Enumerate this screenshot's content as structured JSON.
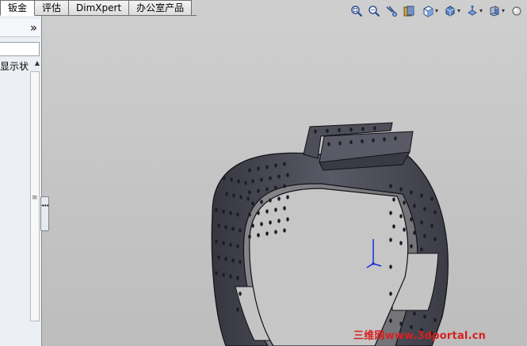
{
  "command_tabs": [
    {
      "label": "钣金",
      "active": true
    },
    {
      "label": "评估",
      "active": false
    },
    {
      "label": "DimXpert",
      "active": false
    },
    {
      "label": "办公室产品",
      "active": false
    }
  ],
  "feature_manager": {
    "expand_label": "»",
    "tree_item_label": "显示状",
    "scroll_up_glyph": "▲",
    "grip_glyph": "≡",
    "collapse_glyph": "◂◂◂"
  },
  "heads_up_toolbar": {
    "icons": [
      "zoom-to-fit-icon",
      "zoom-to-area-icon",
      "previous-view-icon",
      "section-view-icon",
      "view-orientation-icon",
      "display-style-icon",
      "hide-show-items-icon",
      "edit-appearance-icon"
    ],
    "dropdown_glyph": "▾"
  },
  "watermark": {
    "text_cn": "三维网",
    "text_url": "www.3dportal.cn"
  },
  "colors": {
    "part_body": "#4a4a55",
    "part_edge": "#15151a",
    "hole": "#1d1d24",
    "triad": "#1a2ad8",
    "watermark": "#d72020"
  }
}
